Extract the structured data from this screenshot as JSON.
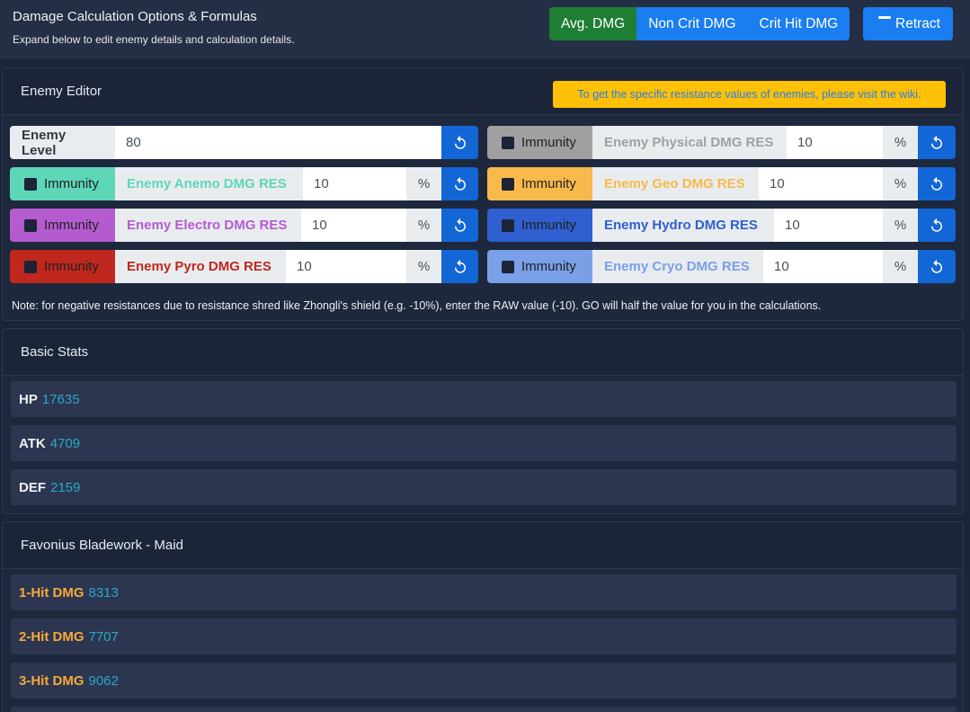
{
  "header": {
    "title": "Damage Calculation Options & Formulas",
    "subtitle": "Expand below to edit enemy details and calculation details.",
    "modes": [
      "Avg. DMG",
      "Non Crit DMG",
      "Crit Hit DMG"
    ],
    "active_mode": "Avg. DMG",
    "retract_label": "Retract"
  },
  "enemy_editor": {
    "title": "Enemy Editor",
    "wiki_notice": "To get the specific resistance values of enemies, please visit the wiki.",
    "level_label": "Enemy Level",
    "level_value": "80",
    "immunity_label": "Immunity",
    "percent": "%",
    "resistances": [
      {
        "label": "Enemy Physical DMG RES",
        "value": "10",
        "color": "#a0a0a0"
      },
      {
        "label": "Enemy Anemo DMG RES",
        "value": "10",
        "color": "#5ed6b8"
      },
      {
        "label": "Enemy Geo DMG RES",
        "value": "10",
        "color": "#f8b94c"
      },
      {
        "label": "Enemy Electro DMG RES",
        "value": "10",
        "color": "#b45bd0"
      },
      {
        "label": "Enemy Hydro DMG RES",
        "value": "10",
        "color": "#2f5fd0"
      },
      {
        "label": "Enemy Pyro DMG RES",
        "value": "10",
        "color": "#c0281e"
      },
      {
        "label": "Enemy Cryo DMG RES",
        "value": "10",
        "color": "#7aa0e8"
      }
    ],
    "note": "Note: for negative resistances due to resistance shred like Zhongli's shield (e.g. -10%), enter the RAW value (-10). GO will half the value for you in the calculations."
  },
  "basic_stats": {
    "title": "Basic Stats",
    "items": [
      {
        "label": "HP",
        "value": "17635"
      },
      {
        "label": "ATK",
        "value": "4709"
      },
      {
        "label": "DEF",
        "value": "2159"
      }
    ]
  },
  "talent": {
    "title": "Favonius Bladework - Maid",
    "items": [
      {
        "label": "1-Hit DMG",
        "value": "8313"
      },
      {
        "label": "2-Hit DMG",
        "value": "7707"
      },
      {
        "label": "3-Hit DMG",
        "value": "9062"
      }
    ]
  },
  "icons": {
    "reset": "undo-icon",
    "retract": "minus-icon",
    "checkbox": "checkbox-icon"
  }
}
